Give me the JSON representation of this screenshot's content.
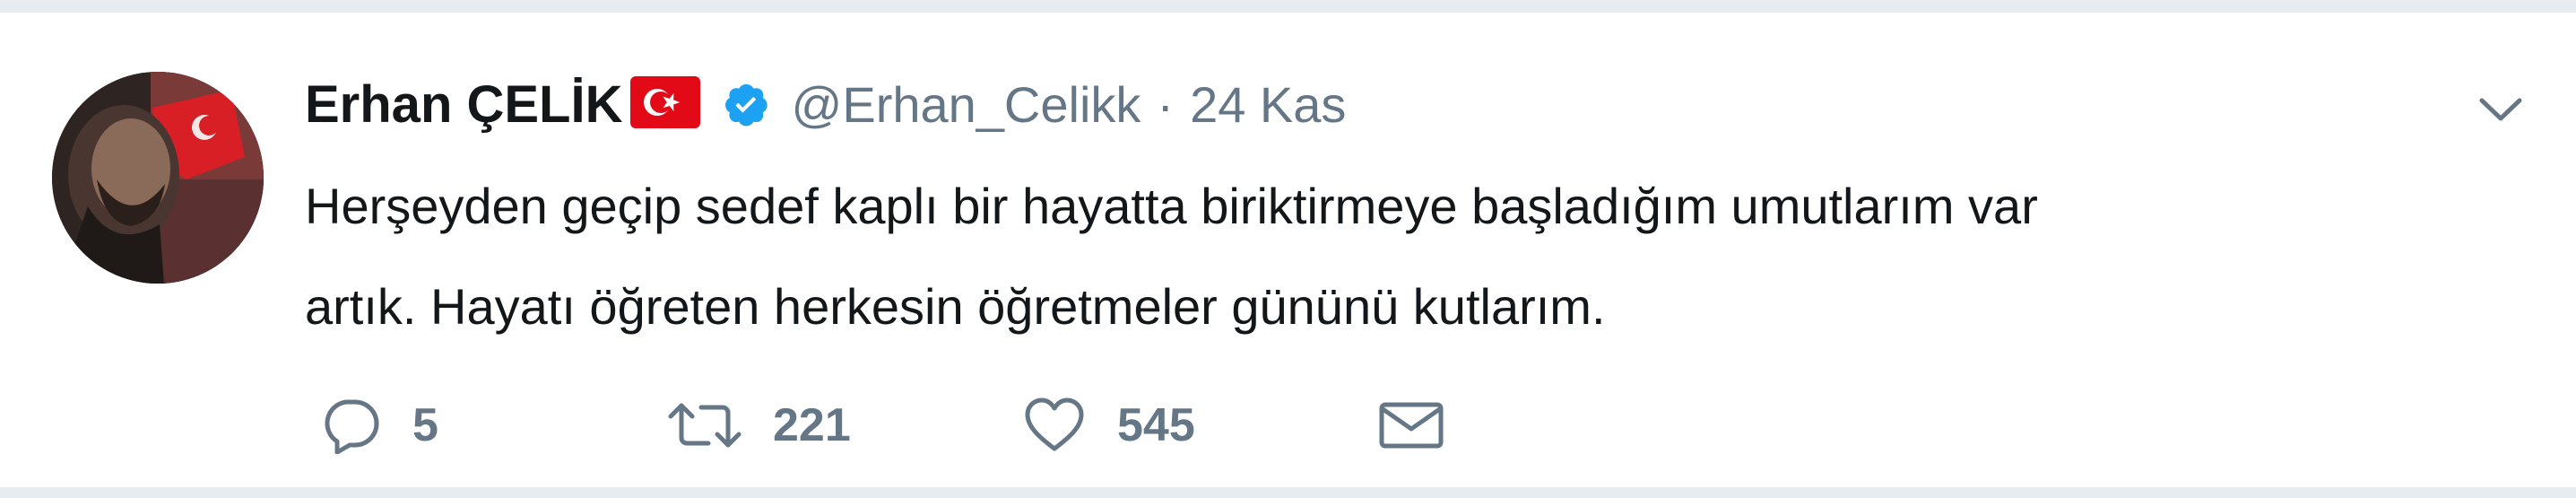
{
  "tweet": {
    "display_name": "Erhan ÇELİK",
    "handle": "@Erhan_Celikk",
    "separator": "·",
    "date": "24 Kas",
    "text_lines": [
      "Herşeyden geçip sedef kaplı bir hayatta biriktirmeye başladığım umutlarım var",
      "artık. Hayatı öğreten herkesin öğretmeler gününü kutlarım."
    ],
    "reply_count": "5",
    "retweet_count": "221",
    "like_count": "545"
  },
  "icons": {
    "flag": "turkey-flag-icon",
    "verified": "verified-badge-icon",
    "menu": "chevron-down-icon",
    "reply": "reply-icon",
    "retweet": "retweet-icon",
    "like": "heart-icon",
    "dm": "envelope-icon"
  },
  "colors": {
    "text": "#14171a",
    "muted": "#657786",
    "verified": "#1da1f2",
    "flag_red": "#e30a17",
    "border": "#e6ecf0"
  }
}
